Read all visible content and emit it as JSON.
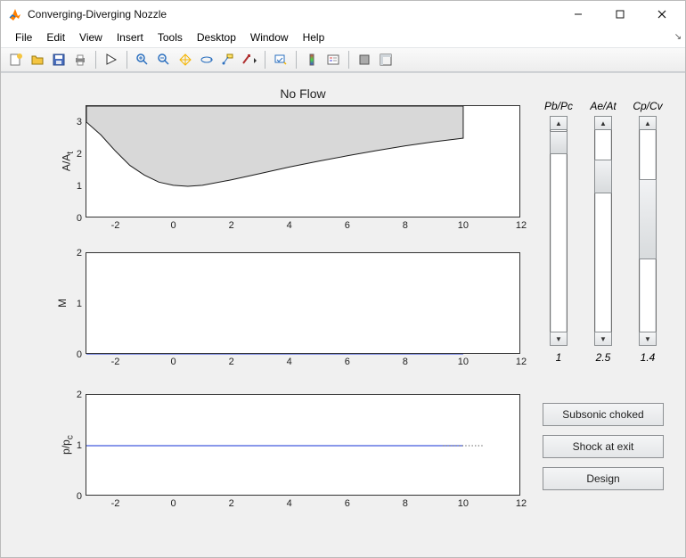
{
  "window": {
    "title": "Converging-Diverging Nozzle"
  },
  "menu": {
    "file": "File",
    "edit": "Edit",
    "view": "View",
    "insert": "Insert",
    "tools": "Tools",
    "desktop": "Desktop",
    "window": "Window",
    "help": "Help"
  },
  "figure": {
    "title": "No Flow",
    "axes1": {
      "ylabel": "A/A_t",
      "yticks": [
        "0",
        "1",
        "2",
        "3"
      ],
      "xticks": [
        "-2",
        "0",
        "2",
        "4",
        "6",
        "8",
        "10",
        "12"
      ],
      "xrange": [
        -3,
        12
      ],
      "yrange": [
        0,
        3.5
      ]
    },
    "axes2": {
      "ylabel": "M",
      "yticks": [
        "0",
        "1",
        "2"
      ],
      "xticks": [
        "-2",
        "0",
        "2",
        "4",
        "6",
        "8",
        "10",
        "12"
      ],
      "xrange": [
        -3,
        12
      ],
      "yrange": [
        0,
        2
      ]
    },
    "axes3": {
      "ylabel": "p/p_c",
      "yticks": [
        "0",
        "1",
        "2"
      ],
      "xticks": [
        "-2",
        "0",
        "2",
        "4",
        "6",
        "8",
        "10",
        "12"
      ],
      "xrange": [
        -3,
        12
      ],
      "yrange": [
        0,
        2
      ]
    }
  },
  "sliders": {
    "pbpc": {
      "label": "Pb/Pc",
      "value": "1",
      "frac": 0.0,
      "thumbh": 26
    },
    "aeat": {
      "label": "Ae/At",
      "value": "2.5",
      "frac": 0.17,
      "thumbh": 38
    },
    "cpcv": {
      "label": "Cp/Cv",
      "value": "1.4",
      "frac": 0.4,
      "thumbh": 90
    }
  },
  "buttons": {
    "b1": "Subsonic choked",
    "b2": "Shock at exit",
    "b3": "Design"
  },
  "chart_data": [
    {
      "type": "area",
      "title": "No Flow",
      "ylabel": "A/A_t",
      "xlim": [
        -3,
        12
      ],
      "ylim": [
        0,
        3.5
      ],
      "x": [
        -3,
        -2.5,
        -2,
        -1.5,
        -1,
        -0.5,
        0,
        0.5,
        1,
        2,
        3,
        4,
        5,
        6,
        7,
        8,
        9,
        10
      ],
      "values": [
        3.0,
        2.6,
        2.1,
        1.65,
        1.35,
        1.13,
        1.03,
        1.0,
        1.03,
        1.2,
        1.4,
        1.6,
        1.78,
        1.95,
        2.11,
        2.26,
        2.39,
        2.5
      ],
      "fill_top": 3.5,
      "fill_color": "#d8d8d8",
      "line_color": "#1a1a1a"
    },
    {
      "type": "line",
      "ylabel": "M",
      "xlim": [
        -3,
        12
      ],
      "ylim": [
        0,
        2
      ],
      "x": [
        -3,
        10
      ],
      "values": [
        0,
        0
      ],
      "color": "#1330d6"
    },
    {
      "type": "line",
      "ylabel": "p/p_c",
      "xlim": [
        -3,
        12
      ],
      "ylim": [
        0,
        2
      ],
      "series": [
        {
          "name": "solid",
          "x": [
            -3,
            10
          ],
          "values": [
            1,
            1
          ],
          "color": "#1330d6",
          "dash": ""
        },
        {
          "name": "dotted",
          "x": [
            9.3,
            10.7
          ],
          "values": [
            1,
            1
          ],
          "color": "#444",
          "dash": "1.2 2.4"
        }
      ]
    }
  ]
}
